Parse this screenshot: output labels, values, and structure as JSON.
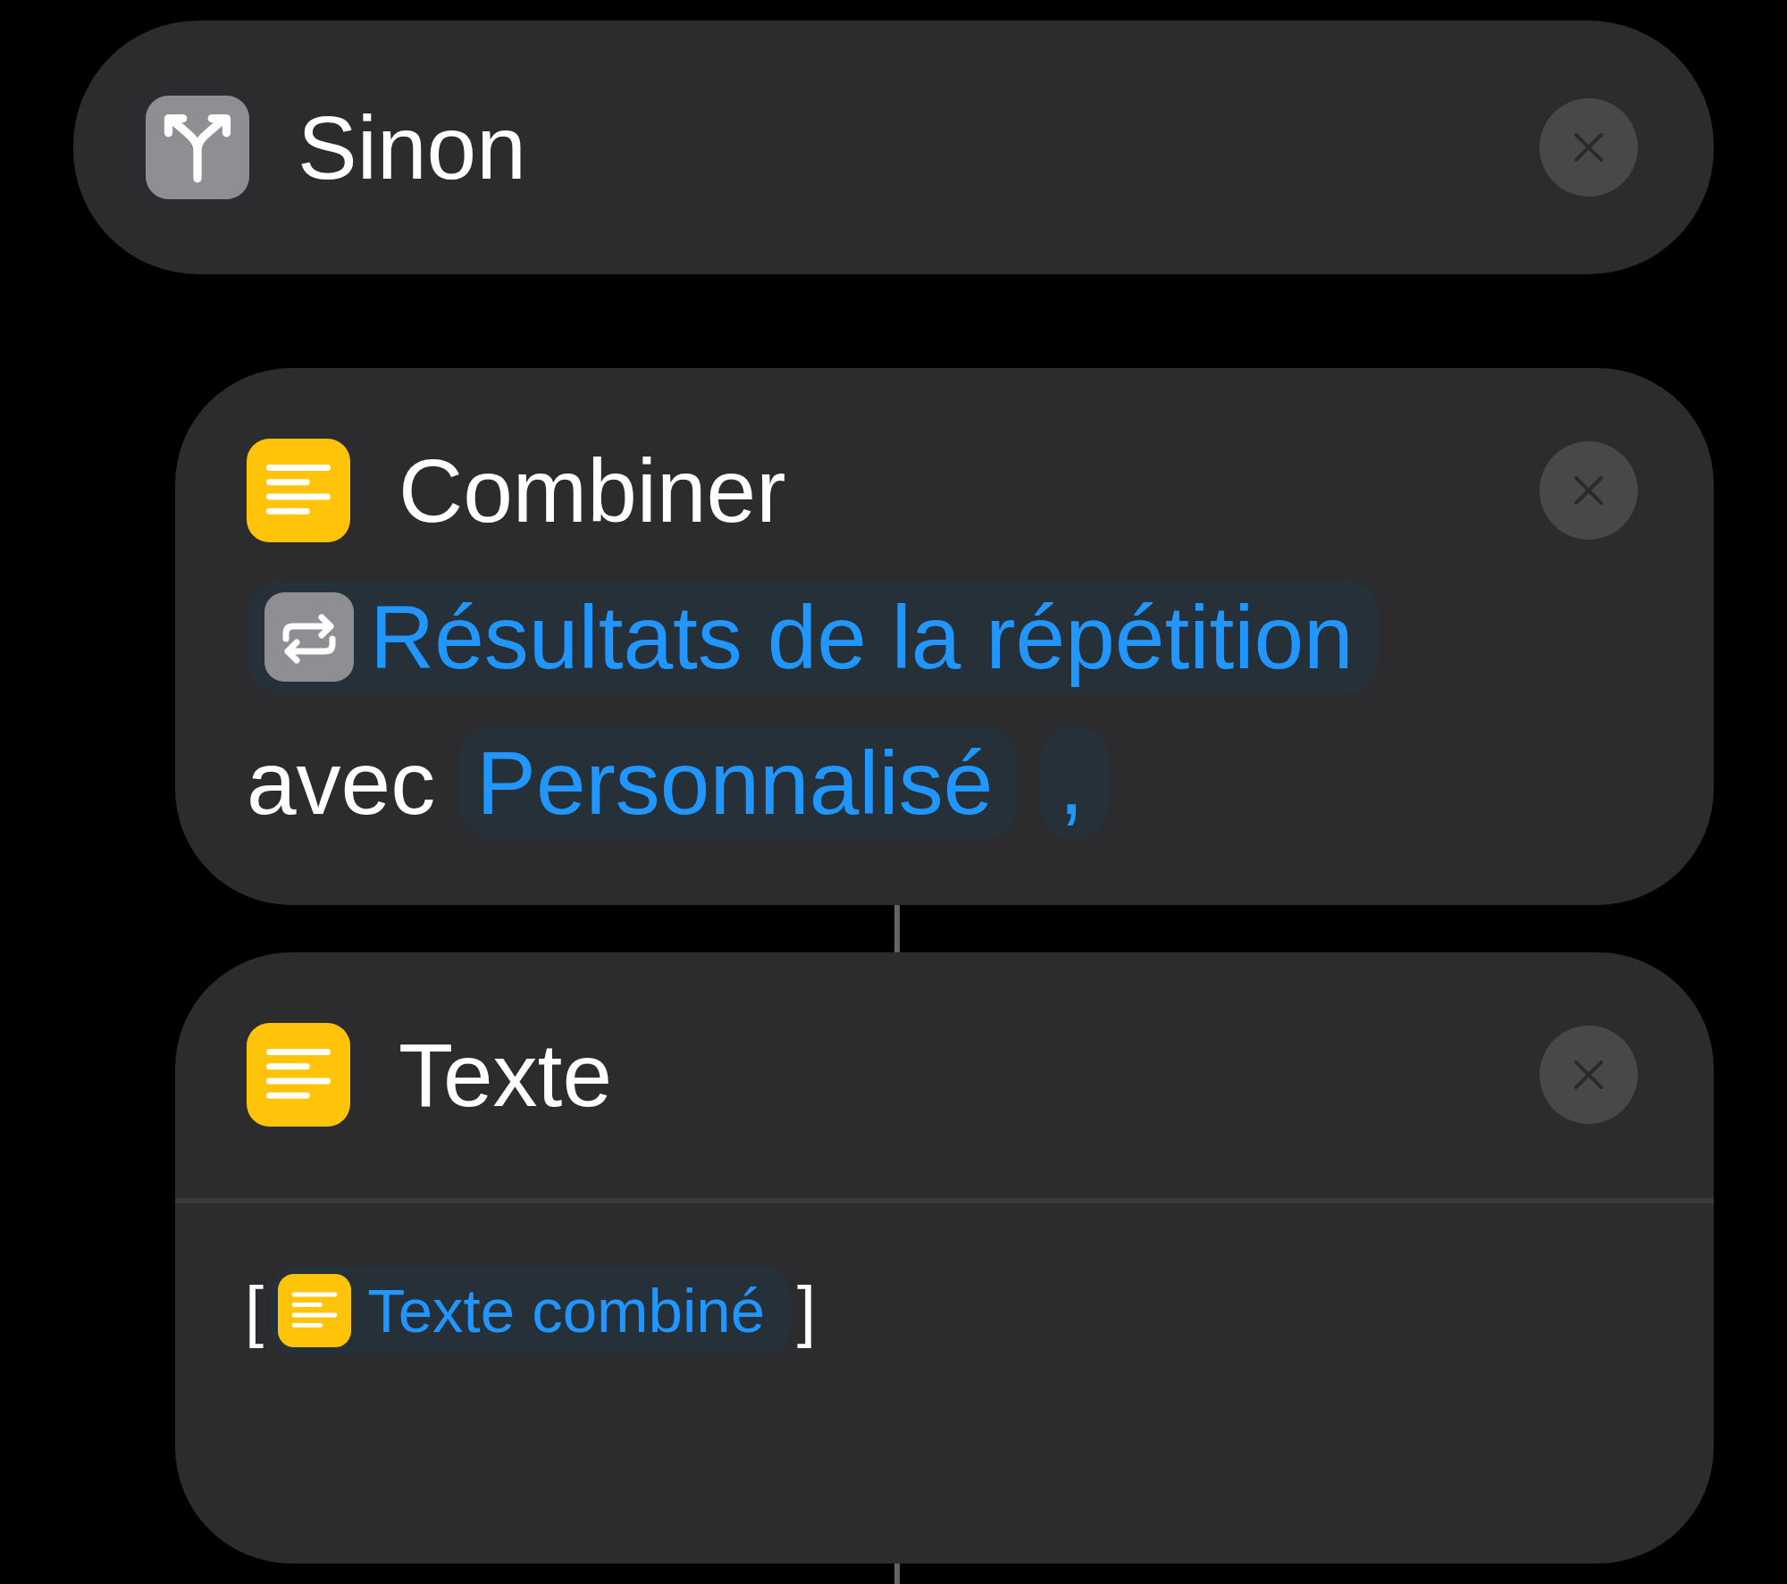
{
  "blocks": [
    {
      "kind": "condition",
      "title": "Sinon",
      "indented": false
    },
    {
      "kind": "text",
      "title": "Combiner",
      "indented": true,
      "lines": [
        [
          {
            "kind": "repeat-variable",
            "text": "Résultats de la répétition"
          }
        ],
        [
          {
            "kind": "word",
            "text": "avec"
          },
          {
            "kind": "variable",
            "text": "Personnalisé"
          },
          {
            "kind": "variable",
            "text": ","
          }
        ]
      ]
    },
    {
      "kind": "text",
      "title": "Texte",
      "indented": true,
      "body": [
        {
          "kind": "word",
          "text": "["
        },
        {
          "kind": "text-variable",
          "text": "Texte combiné"
        },
        {
          "kind": "word",
          "text": "]"
        }
      ]
    }
  ]
}
